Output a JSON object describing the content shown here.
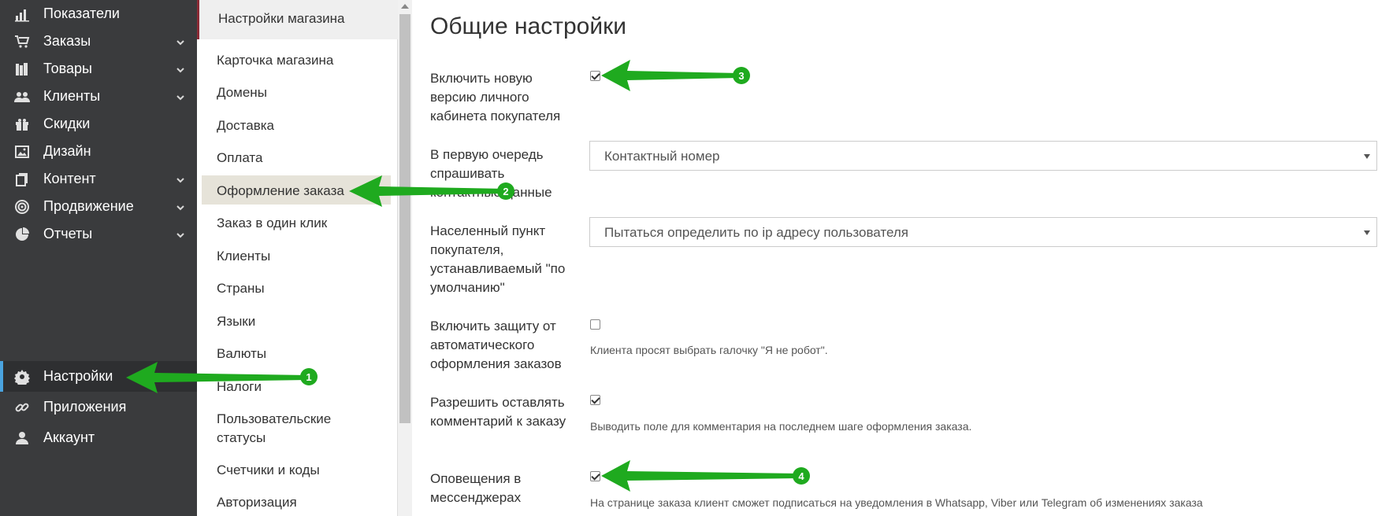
{
  "sidebar": {
    "items": [
      {
        "label": "Показатели",
        "icon": "bar-chart-icon"
      },
      {
        "label": "Заказы",
        "icon": "cart-icon"
      },
      {
        "label": "Товары",
        "icon": "books-icon"
      },
      {
        "label": "Клиенты",
        "icon": "users-icon"
      },
      {
        "label": "Скидки",
        "icon": "gift-icon"
      },
      {
        "label": "Дизайн",
        "icon": "image-icon"
      },
      {
        "label": "Контент",
        "icon": "copy-icon"
      },
      {
        "label": "Продвижение",
        "icon": "target-icon"
      },
      {
        "label": "Отчеты",
        "icon": "pie-chart-icon"
      }
    ],
    "bottom_items": [
      {
        "label": "Настройки",
        "icon": "gear-icon"
      },
      {
        "label": "Приложения",
        "icon": "link-icon"
      },
      {
        "label": "Аккаунт",
        "icon": "user-icon"
      }
    ]
  },
  "submenu": {
    "header": "Настройки магазина",
    "items": [
      "Карточка магазина",
      "Домены",
      "Доставка",
      "Оплата",
      "Оформление заказа",
      "Заказ в один клик",
      "Клиенты",
      "Страны",
      "Языки",
      "Валюты",
      "Налоги",
      "Пользовательские статусы",
      "Счетчики и коды",
      "Авторизация"
    ],
    "selected": "Оформление заказа"
  },
  "main": {
    "title": "Общие настройки",
    "settings": [
      {
        "label": "Включить новую версию личного кабинета покупателя",
        "checked": true
      },
      {
        "label": "В первую очередь спрашивать контактные данные",
        "select_value": "Контактный номер"
      },
      {
        "label": "Населенный пункт покупателя, устанавливаемый \"по умолчанию\"",
        "select_value": "Пытаться определить по ip адресу пользователя"
      },
      {
        "label": "Включить защиту от автоматического оформления заказов",
        "checked": false,
        "hint": "Клиента просят выбрать галочку \"Я не робот\"."
      },
      {
        "label": "Разрешить оставлять комментарий к заказу",
        "checked": true,
        "hint": "Выводить поле для комментария на последнем шаге оформления заказа."
      },
      {
        "label": "Оповещения в мессенджерах",
        "checked": true,
        "hint": "На странице заказа клиент сможет подписаться на уведомления в Whatsapp, Viber или Telegram об изменениях заказа"
      }
    ]
  },
  "annotations": {
    "badges": [
      "1",
      "2",
      "3",
      "4"
    ],
    "color": "#1faa1f"
  }
}
